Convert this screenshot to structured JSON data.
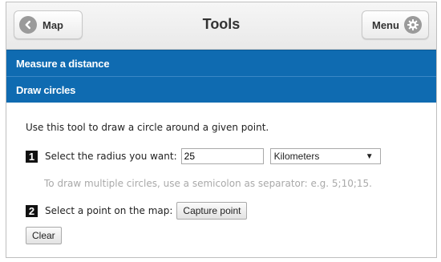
{
  "header": {
    "back_label": "Map",
    "title": "Tools",
    "menu_label": "Menu",
    "back_icon": "chevron-left-icon",
    "menu_icon": "gear-icon"
  },
  "sections": {
    "measure_label": "Measure a distance",
    "circles_label": "Draw circles"
  },
  "content": {
    "intro": "Use this tool to draw a circle around a given point.",
    "step1_number": "1",
    "step1_label": "Select the radius you want:",
    "radius_value": "25",
    "unit_selected": "Kilometers",
    "hint": "To draw multiple circles, use a semicolon as separator: e.g. 5;10;15.",
    "step2_number": "2",
    "step2_label": "Select a point on the map:",
    "capture_label": "Capture point",
    "clear_label": "Clear"
  },
  "colors": {
    "bar": "#0f6bb1",
    "hint": "#a9a9a9"
  }
}
